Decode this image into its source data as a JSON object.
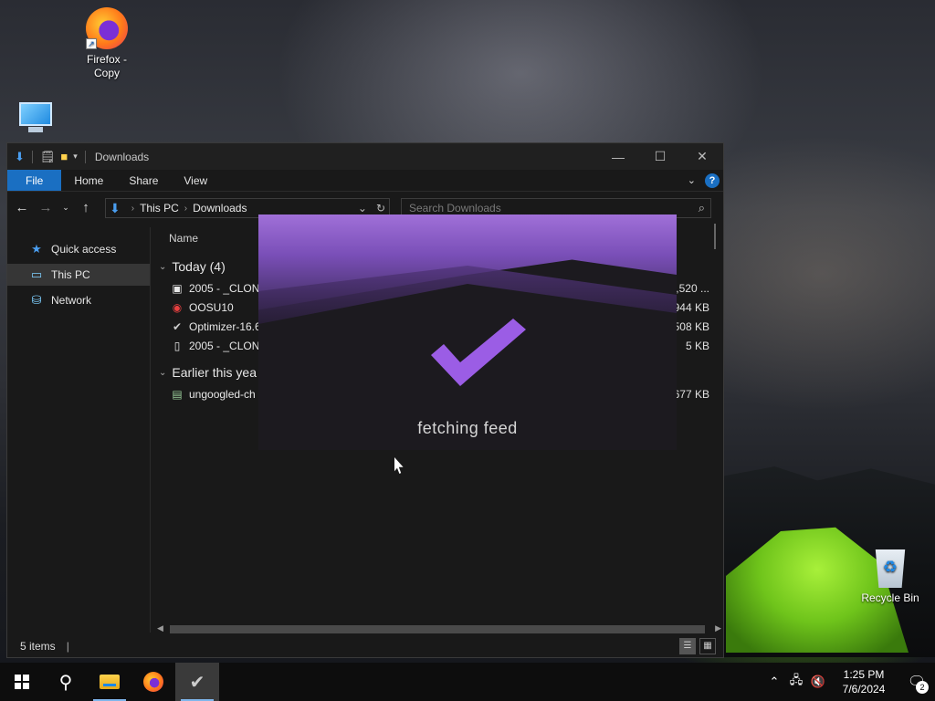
{
  "desktop": {
    "icons": [
      {
        "label": "Firefox - Copy",
        "icon": "firefox-icon"
      },
      {
        "label": "",
        "icon": "this-pc-icon"
      },
      {
        "label": "Recycle Bin",
        "icon": "recycle-bin-icon"
      }
    ]
  },
  "window": {
    "title": "Downloads",
    "ribbon_tabs": [
      "File",
      "Home",
      "Share",
      "View"
    ],
    "address": {
      "root": "This PC",
      "current": "Downloads"
    },
    "search_placeholder": "Search Downloads",
    "nav": [
      {
        "label": "Quick access",
        "icon": "star-icon"
      },
      {
        "label": "This PC",
        "icon": "computer-icon",
        "active": true
      },
      {
        "label": "Network",
        "icon": "network-icon"
      }
    ],
    "column_name": "Name",
    "groups": [
      {
        "label": "Today (4)",
        "files": [
          {
            "name": "2005 - _CLONE",
            "size": ",520 ...",
            "icon": "installer-icon"
          },
          {
            "name": "OOSU10",
            "size": "944 KB",
            "icon": "oosu-icon"
          },
          {
            "name": "Optimizer-16.6",
            "size": "508 KB",
            "icon": "checkmark-icon"
          },
          {
            "name": "2005 - _CLONE",
            "size": "5 KB",
            "icon": "document-icon"
          }
        ]
      },
      {
        "label": "Earlier this yea",
        "files": [
          {
            "name": "ungoogled-ch",
            "size": "677 KB",
            "icon": "archive-icon"
          }
        ]
      }
    ],
    "status": "5 items"
  },
  "overlay": {
    "message": "fetching feed",
    "accent": "#9b5de5"
  },
  "taskbar": {
    "apps": [
      "start-icon",
      "search-icon",
      "file-explorer-icon",
      "firefox-icon",
      "optimizer-icon"
    ],
    "time": "1:25 PM",
    "date": "7/6/2024",
    "notification_count": "2"
  }
}
